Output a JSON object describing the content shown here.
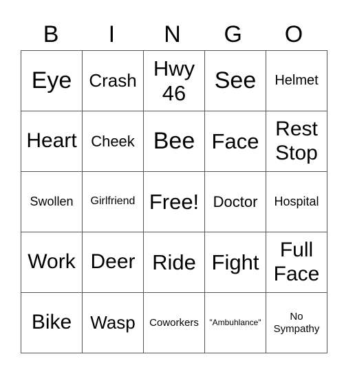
{
  "header": [
    "B",
    "I",
    "N",
    "G",
    "O"
  ],
  "rows": [
    [
      "Eye",
      "Crash",
      "Hwy 46",
      "See",
      "Helmet"
    ],
    [
      "Heart",
      "Cheek",
      "Bee",
      "Face",
      "Rest Stop"
    ],
    [
      "Swollen",
      "Girlfriend",
      "Free!",
      "Doctor",
      "Hospital"
    ],
    [
      "Work",
      "Deer",
      "Ride",
      "Fight",
      "Full Face"
    ],
    [
      "Bike",
      "Wasp",
      "Coworkers",
      "\"Ambuhlance\"",
      "No Sympathy"
    ]
  ]
}
